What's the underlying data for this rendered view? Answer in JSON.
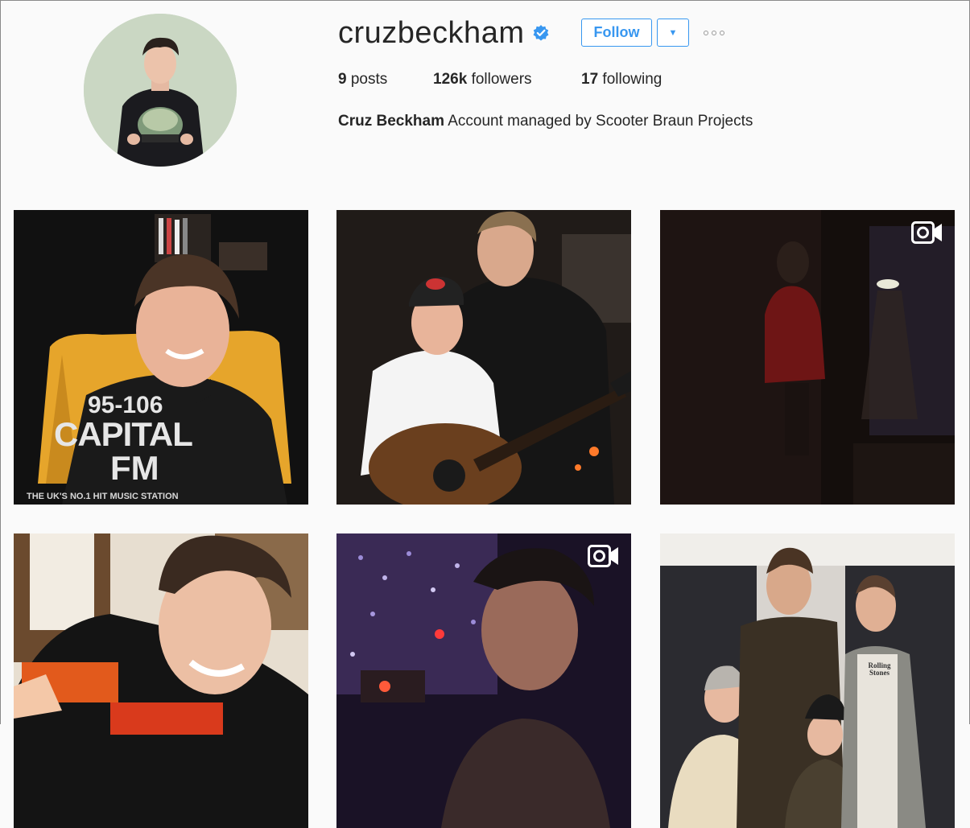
{
  "profile": {
    "username": "cruzbeckham",
    "follow_label": "Follow",
    "stats": {
      "posts_count": "9",
      "posts_label": "posts",
      "followers_count": "126k",
      "followers_label": "followers",
      "following_count": "17",
      "following_label": "following"
    },
    "bio_name": "Cruz Beckham",
    "bio_text": "Account managed by Scooter Braun Projects"
  },
  "posts": [
    {
      "id": "post-1",
      "type": "photo",
      "overlay": {
        "line1": "95-106",
        "line2": "CAPITAL",
        "line3": "FM",
        "tagline": "THE UK'S NO.1 HIT MUSIC STATION"
      }
    },
    {
      "id": "post-2",
      "type": "photo"
    },
    {
      "id": "post-3",
      "type": "video"
    },
    {
      "id": "post-4",
      "type": "photo"
    },
    {
      "id": "post-5",
      "type": "video"
    },
    {
      "id": "post-6",
      "type": "photo",
      "shirt_text": "Rolling Stones"
    }
  ],
  "colors": {
    "accent": "#3897f0",
    "verified": "#3897f0",
    "background": "#fafafa",
    "text": "#262626"
  },
  "icons": {
    "verified": "verified-badge-icon",
    "dropdown": "caret-down-icon",
    "more": "ellipsis-icon",
    "video": "video-camera-icon"
  }
}
